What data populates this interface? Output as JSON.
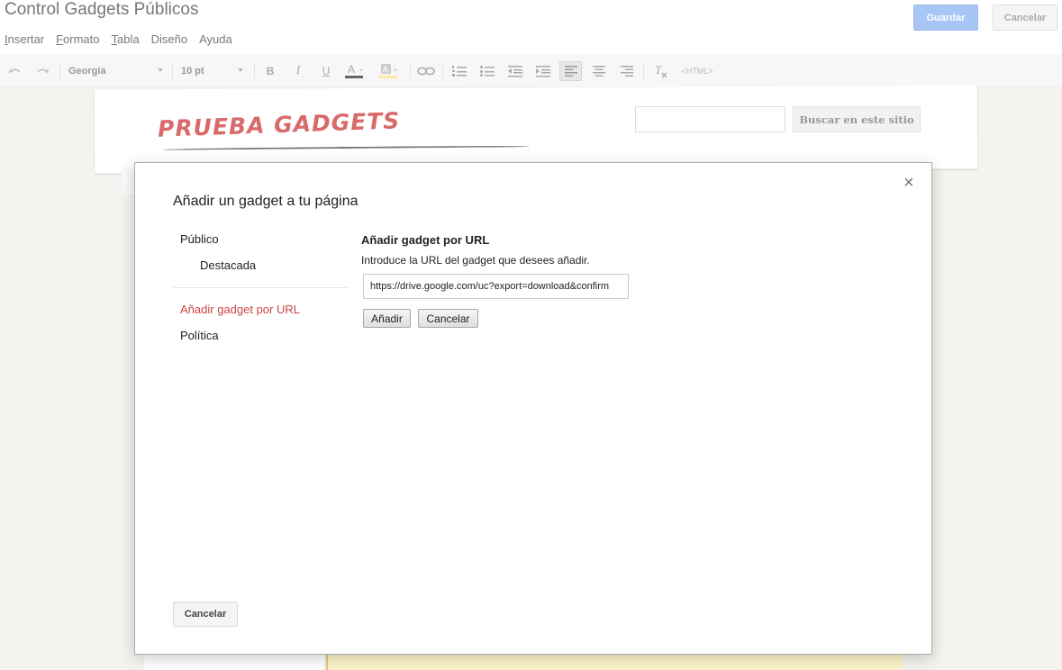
{
  "header": {
    "title": "Control Gadgets Públicos",
    "save_label": "Guardar",
    "cancel_label": "Cancelar"
  },
  "menu": [
    {
      "prefix": "",
      "underline": "I",
      "rest": "nsertar"
    },
    {
      "prefix": "",
      "underline": "F",
      "rest": "ormato"
    },
    {
      "prefix": "",
      "underline": "T",
      "rest": "abla"
    },
    {
      "prefix": "",
      "underline": "",
      "rest": "Diseño"
    },
    {
      "prefix": "",
      "underline": "",
      "rest": "Ayuda"
    }
  ],
  "toolbar": {
    "font": "Georgia",
    "size": "10 pt",
    "html_label": "<HTML>",
    "colors": {
      "text_color": "#666666",
      "highlight_color": "#ffe9a8"
    }
  },
  "site": {
    "brand": "PRUEBA GADGETS",
    "search_button": "Buscar en este sitio",
    "search_value": ""
  },
  "dialog": {
    "title": "Añadir un gadget a tu página",
    "close_symbol": "×",
    "nav": {
      "public": "Público",
      "featured": "Destacada",
      "add_by_url": "Añadir gadget por URL",
      "policy": "Política"
    },
    "url_section": {
      "heading": "Añadir gadget por URL",
      "description": "Introduce la URL del gadget que desees añadir.",
      "url_value": "https://drive.google.com/uc?export=download&confirm",
      "add_label": "Añadir",
      "cancel_label": "Cancelar"
    },
    "cancel_label": "Cancelar",
    "accent_color": "#cc4444"
  }
}
